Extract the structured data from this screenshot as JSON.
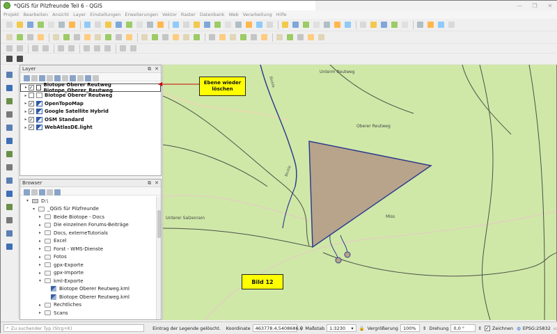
{
  "window": {
    "title": "*QGIS für Pilzfreunde Teil 6 - QGIS",
    "controls": [
      "—",
      "❐",
      "✕"
    ]
  },
  "menu": [
    "Projekt",
    "Bearbeiten",
    "Ansicht",
    "Layer",
    "Einstellungen",
    "Erweiterungen",
    "Vektor",
    "Raster",
    "Datenbank",
    "Web",
    "Verarbeitung",
    "Hilfe"
  ],
  "layers_panel": {
    "title": "Layer",
    "items": [
      {
        "label": "Biotope Oberer Reutweg Biotope_Oberer_Reutweg",
        "checked": true,
        "selected": true,
        "icon": "polygon-layer-icon"
      },
      {
        "label": "Biotope Oberer Reutweg",
        "checked": false,
        "selected": false,
        "icon": "vector-layer-icon"
      },
      {
        "label": "OpenTopoMap",
        "checked": true,
        "selected": false,
        "icon": "raster-layer-icon"
      },
      {
        "label": "Google Satellite Hybrid",
        "checked": true,
        "selected": false,
        "icon": "raster-layer-icon"
      },
      {
        "label": "OSM Standard",
        "checked": true,
        "selected": false,
        "icon": "raster-layer-icon"
      },
      {
        "label": "WebAtlasDE.light",
        "checked": true,
        "selected": false,
        "icon": "raster-layer-icon"
      }
    ]
  },
  "browser_panel": {
    "title": "Browser",
    "items": [
      {
        "label": "D:\\",
        "indent": 1,
        "icon": "drive-icon",
        "expanded": true
      },
      {
        "label": "_QGIS für Pilzfreunde",
        "indent": 2,
        "icon": "folder-icon",
        "expanded": true
      },
      {
        "label": "Beide Biotope - Docs",
        "indent": 3,
        "icon": "folder-icon"
      },
      {
        "label": "Die einzelnen Forums-Beiträge",
        "indent": 3,
        "icon": "folder-icon"
      },
      {
        "label": "Docs, externeTutorials",
        "indent": 3,
        "icon": "folder-icon"
      },
      {
        "label": "Excel",
        "indent": 3,
        "icon": "folder-icon"
      },
      {
        "label": "Forst - WMS-Dienste",
        "indent": 3,
        "icon": "folder-icon"
      },
      {
        "label": "Fotos",
        "indent": 3,
        "icon": "folder-icon"
      },
      {
        "label": "gpx-Exporte",
        "indent": 3,
        "icon": "folder-icon"
      },
      {
        "label": "gpx-Importe",
        "indent": 3,
        "icon": "folder-icon"
      },
      {
        "label": "kml-Exporte",
        "indent": 3,
        "icon": "folder-icon",
        "expanded": true
      },
      {
        "label": "Biotope Oberer Reutweg.kml",
        "indent": 4,
        "icon": "kml-file-icon"
      },
      {
        "label": "Biotope Oberer Reutweg.kml",
        "indent": 4,
        "icon": "kml-file-icon"
      },
      {
        "label": "Rechtliches",
        "indent": 3,
        "icon": "folder-icon"
      },
      {
        "label": "Scans",
        "indent": 3,
        "icon": "folder-icon"
      }
    ]
  },
  "map": {
    "labels": [
      "Unterm Reutweg",
      "Oberer Reutweg",
      "Unterer Salzenrain",
      "Miss",
      "Bickle",
      "Bickle"
    ],
    "callout": {
      "line1": "Ebene wieder",
      "line2": "löschen"
    },
    "figure_label": "Bild 12",
    "colors": {
      "background": "#cfe8a8",
      "polygon_fill": "#b7a48b",
      "polygon_stroke": "#2f3d8c",
      "callout": "#ffff00",
      "arrow": "#cc0000"
    }
  },
  "statusbar": {
    "search_placeholder": "Zu suchender Typ (Strg+K)",
    "message": "Eintrag der Legende gelöscht.",
    "coord_label": "Koordinate",
    "coord_value": "463778.4,5408686.0",
    "scale_label": "Maßstab",
    "scale_value": "1:3230",
    "magnifier_label": "Vergrößerung",
    "magnifier_value": "100%",
    "rotation_label": "Drehung",
    "rotation_value": "0,0 °",
    "render_label": "Zeichnen",
    "crs": "EPSG:25832"
  }
}
